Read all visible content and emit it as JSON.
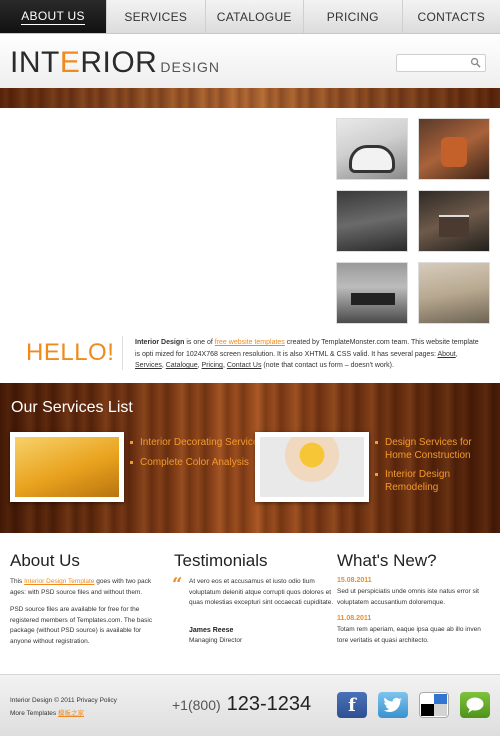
{
  "nav": {
    "items": [
      {
        "label": "ABOUT US",
        "active": true
      },
      {
        "label": "SERVICES",
        "active": false
      },
      {
        "label": "CATALOGUE",
        "active": false
      },
      {
        "label": "PRICING",
        "active": false
      },
      {
        "label": "CONTACTS",
        "active": false
      }
    ]
  },
  "header": {
    "logo_part1": "INT",
    "logo_o": "E",
    "logo_part2": "RIOR",
    "logo_sub": "DESIGN",
    "search_icon": "search-icon"
  },
  "hello": {
    "title": "HELLO!",
    "bold_lead": "Interior Design",
    "text_1": " is one of ",
    "link_free": "free website templates",
    "text_2": " created by TemplateMonster.com team. This website template is opti mized for 1024X768 screen resolution. It is also XHTML & CSS valid. It has several pages: ",
    "page_about": "About",
    "page_services": "Services",
    "page_catalogue": "Catalogue",
    "page_pricing": "Pricing",
    "page_contact": "Contact Us",
    "text_3": " (note that contact us form – doesn't work)."
  },
  "services": {
    "title": "Our Services List",
    "list1": [
      "Interior Decorating Services",
      "Complete Color Analysis"
    ],
    "list2": [
      "Design Services for Home Construction",
      "Interior Design Remodeling"
    ]
  },
  "about": {
    "title": "About Us",
    "p1_pre": "This ",
    "p1_link": "Interior Design Template",
    "p1_post": " goes with two pack ages: with PSD source files and without them.",
    "p2": "PSD source files are available for free for the registered members of Templates.com. The basic package (without PSD source) is available for anyone without registration."
  },
  "testimonials": {
    "title": "Testimonials",
    "quote_mark": "“",
    "text": "At vero eos et accusamus et iusto odio tium voluptatum deleniti atque corrupti quos dolores et quas molestias excepturi sint occaecati cupiditate.",
    "name": "James Reese",
    "role": "Managing Director"
  },
  "news": {
    "title": "What's New?",
    "items": [
      {
        "date": "15.08.2011",
        "text": "Sed ut perspiciatis unde omnis iste natus error sit voluptatem accusantium doloremque."
      },
      {
        "date": "11.08.2011",
        "text": "Totam rem aperiam, eaque ipsa quae ab illo inven tore veritatis et quasi architecto."
      }
    ]
  },
  "footer": {
    "copyright": "Interior Design © 2011 Privacy Policy",
    "more_label": "More Templates ",
    "more_link": "模板之家",
    "phone_code": "+1(800)",
    "phone_number": "123-1234",
    "facebook_glyph": "f"
  },
  "colors": {
    "accent": "#f08a1c",
    "nav_active_bg": "#1a1a1a",
    "wood": "#7a3712"
  }
}
